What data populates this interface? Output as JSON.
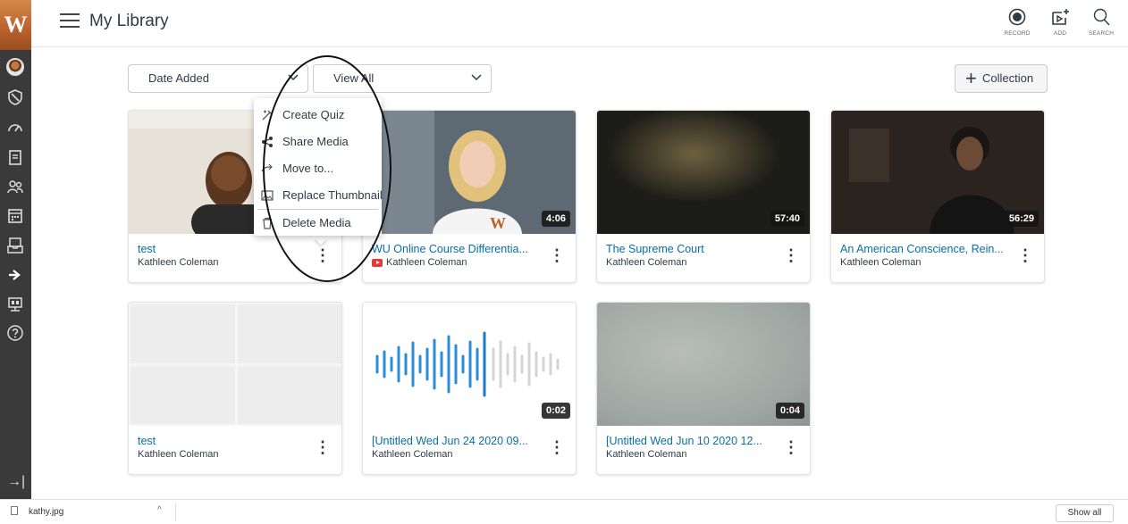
{
  "header": {
    "logo_letter": "W",
    "title": "My Library",
    "tools": [
      {
        "label": "RECORD",
        "icon": "record-icon"
      },
      {
        "label": "ADD",
        "icon": "add-media-icon"
      },
      {
        "label": "SEARCH",
        "icon": "search-icon"
      }
    ]
  },
  "leftnav": {
    "icons": [
      "account-avatar",
      "admin-shield-icon",
      "dashboard-icon",
      "courses-icon",
      "groups-icon",
      "calendar-icon",
      "inbox-icon",
      "commons-icon",
      "studio-icon",
      "help-icon"
    ],
    "collapse_icon": "collapse-nav-icon"
  },
  "filters": {
    "sort": "Date Added",
    "view": "View All",
    "collection_button": "Collection"
  },
  "menu": {
    "items": [
      "Create Quiz",
      "Share Media",
      "Move to...",
      "Replace Thumbnail",
      "Delete Media"
    ]
  },
  "cards": [
    {
      "title": "test",
      "owner": "Kathleen Coleman",
      "duration": ""
    },
    {
      "title": "WU Online Course Differentia...",
      "owner": "Kathleen Coleman",
      "duration": "4:06",
      "youtube": true
    },
    {
      "title": "The Supreme Court",
      "owner": "Kathleen Coleman",
      "duration": "57:40"
    },
    {
      "title": "An American Conscience, Rein...",
      "owner": "Kathleen Coleman",
      "duration": "56:29"
    },
    {
      "title": "test",
      "owner": "Kathleen Coleman",
      "duration": ""
    },
    {
      "title": "[Untitled Wed Jun 24 2020 09...",
      "owner": "Kathleen Coleman",
      "duration": "0:02"
    },
    {
      "title": "[Untitled Wed Jun 10 2020 12...",
      "owner": "Kathleen Coleman",
      "duration": "0:04"
    }
  ],
  "downloads": {
    "file": "kathy.jpg",
    "show_all": "Show all"
  },
  "colors": {
    "link": "#0770a3",
    "nav_bg": "#3a3a3a",
    "logo": "#b8612c",
    "waveform_blue": "#2b8ed6"
  }
}
